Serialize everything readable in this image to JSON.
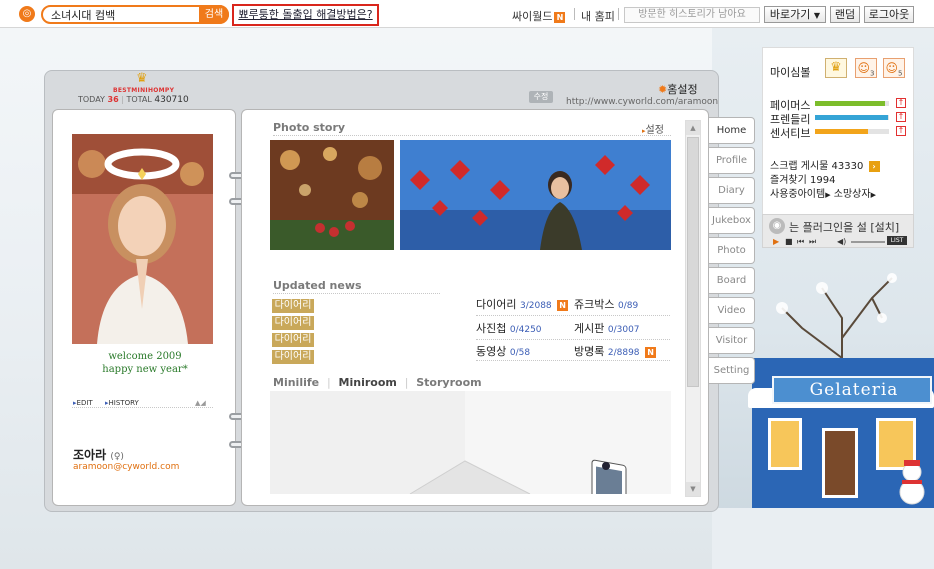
{
  "topbar": {
    "search_value": "소녀시대 컴백",
    "search_button": "검색",
    "notice_link": "뾰루퉁한 돌출입 해결방법은?",
    "cyworld_link": "싸이월드",
    "new_badge": "N",
    "my_home": "내 홈피",
    "history_placeholder": "방문한 히스토리가 남아요",
    "shortcut": "바로가기",
    "random": "랜덤",
    "logout": "로그아웃"
  },
  "header": {
    "best_label": "BESTMINIHOMPY",
    "today_label": "TODAY",
    "today_count": "36",
    "total_label": "TOTAL",
    "total_count": "430710",
    "home_settings": "홈설정",
    "edit_tag": "수정",
    "url": "http://www.cyworld.com/aramoon"
  },
  "profile": {
    "greeting_line1": "welcome 2009",
    "greeting_line2": "happy new year*",
    "edit_link": "EDIT",
    "history_link": "HISTORY",
    "name": "조아라",
    "gender": "(♀)",
    "email": "aramoon@cyworld.com"
  },
  "photo_story": {
    "title": "Photo story",
    "settings_link": "설정"
  },
  "updated_news": {
    "title": "Updated news",
    "chips": [
      "다이어리",
      "다이어리",
      "다이어리",
      "다이어리"
    ]
  },
  "stats": [
    {
      "label": "다이어리",
      "value": "3/2088",
      "new": true
    },
    {
      "label": "쥬크박스",
      "value": "0/89",
      "new": false
    },
    {
      "label": "사진첩",
      "value": "0/4250",
      "new": false
    },
    {
      "label": "게시판",
      "value": "0/3007",
      "new": false
    },
    {
      "label": "동영상",
      "value": "0/58",
      "new": false
    },
    {
      "label": "방명록",
      "value": "2/8898",
      "new": true
    }
  ],
  "mini_tabs": {
    "minilife": "Minilife",
    "miniroom": "Miniroom",
    "storyroom": "Storyroom",
    "sep": "|"
  },
  "side_tabs": [
    "Home",
    "Profile",
    "Diary",
    "Jukebox",
    "Photo",
    "Board",
    "Video",
    "Visitor",
    "Setting"
  ],
  "widget": {
    "title": "마이심볼",
    "badge_counts": [
      "3",
      "5"
    ],
    "bars": [
      {
        "label": "페이머스",
        "level": 0.95,
        "color": "#7cbd2b"
      },
      {
        "label": "프렌들리",
        "level": 0.98,
        "color": "#35a4d6"
      },
      {
        "label": "센서티브",
        "level": 0.72,
        "color": "#f2a41a"
      }
    ],
    "scrap_text": "스크랩 게시물 43330",
    "favorites_text": "즐겨찾기 1994",
    "items_text": "사용중아이템",
    "shop_text": "소망상자"
  },
  "player": {
    "plugin_text": "는 플러그인을 설",
    "install_text": "[설치]",
    "list_text": "LIST"
  },
  "scene": {
    "shop_sign": "Gelateria"
  },
  "colors": {
    "accent": "#f07a1a",
    "notice_border": "#d9261c",
    "link_blue": "#3b5db5",
    "chip_gold": "#c9a85a"
  }
}
